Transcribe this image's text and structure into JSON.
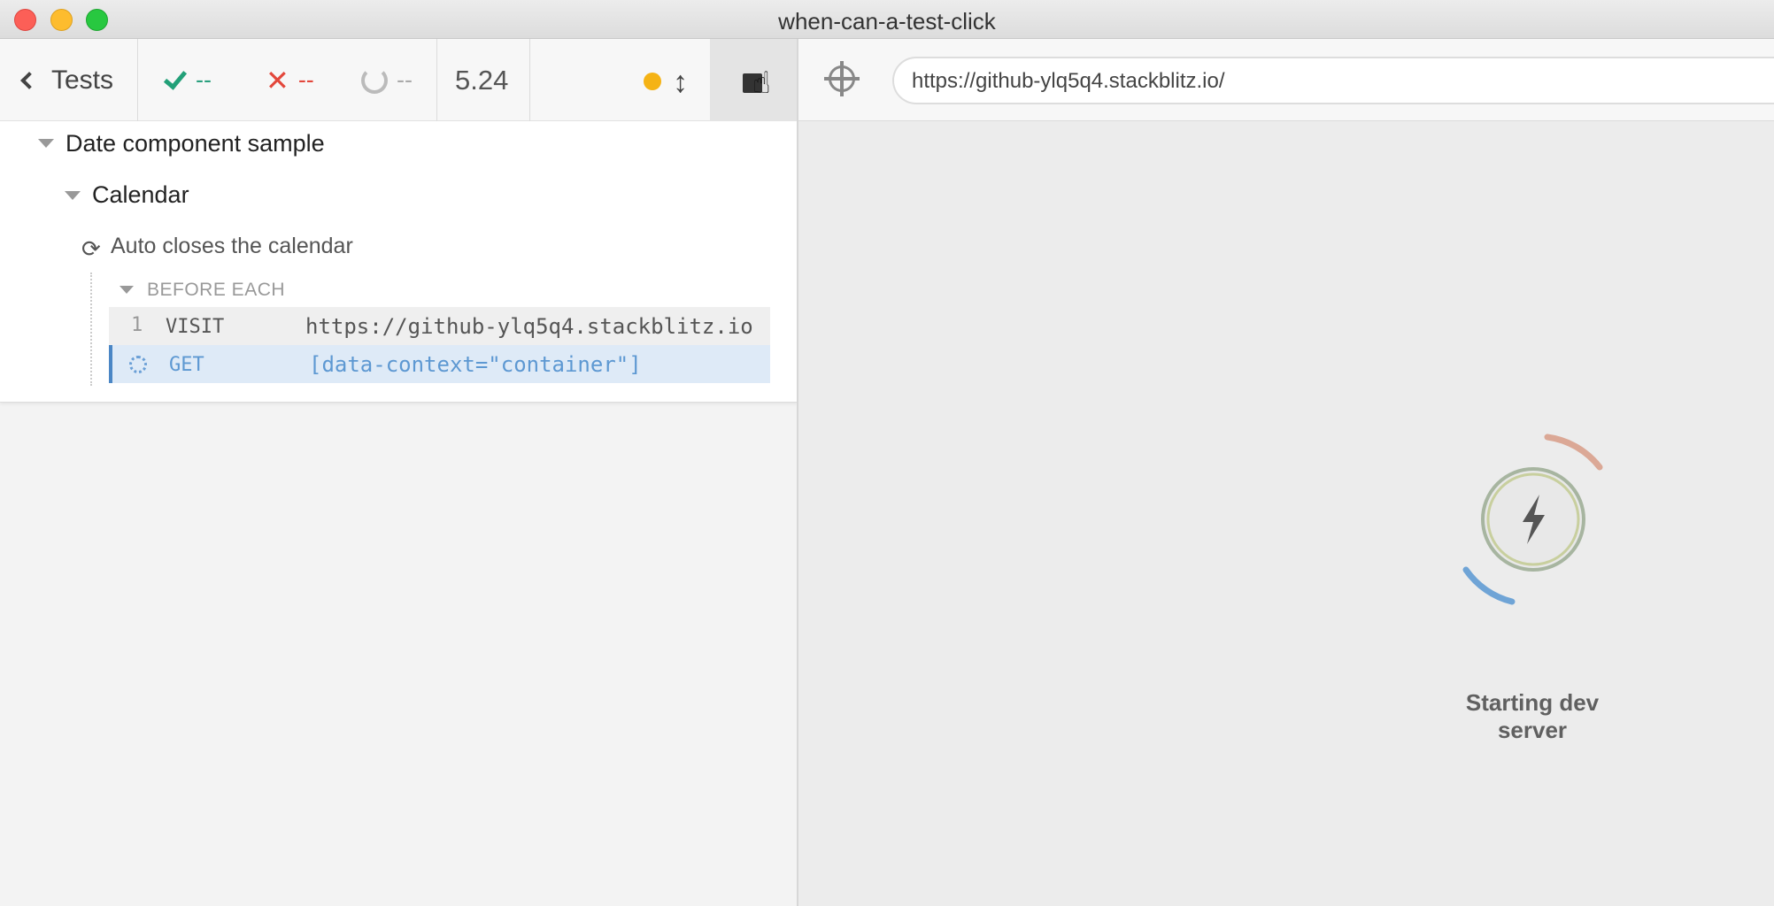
{
  "window": {
    "title": "when-can-a-test-click"
  },
  "header": {
    "back_label": "Tests",
    "passed": "--",
    "failed": "--",
    "pending": "--",
    "duration": "5.24"
  },
  "reporter": {
    "suite": "Date component sample",
    "subsuite": "Calendar",
    "test": "Auto closes the calendar",
    "hook": "BEFORE EACH",
    "commands": [
      {
        "number": "1",
        "name": "VISIT",
        "message": "https://github-ylq5q4.stackblitz.io"
      },
      {
        "number": "",
        "name": "GET",
        "message": "[data-context=\"container\"]"
      }
    ]
  },
  "app": {
    "url": "https://github-ylq5q4.stackblitz.io/",
    "loading_text": "Starting dev server"
  },
  "colors": {
    "pass": "#2aa07e",
    "fail": "#e3473b",
    "running": "#f5b315",
    "active": "#4a86c5"
  }
}
